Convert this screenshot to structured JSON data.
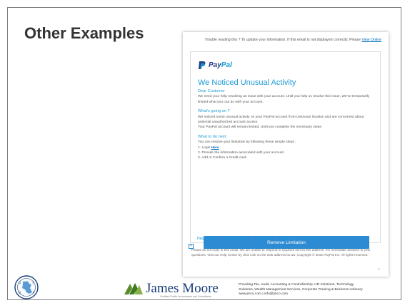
{
  "slide": {
    "title": "Other Examples"
  },
  "email": {
    "notice_text": "Trouble reading this ? To update your information. If this email is not displayed correctly, Please",
    "notice_link": "View Online",
    "logo_text_pay": "Pay",
    "logo_text_pal": "Pal",
    "heading": "We Noticed Unusual Activity",
    "greeting": "Dear Customer",
    "intro": "We need your help resolving an issue with your account. Until you help us resolve this issue, We've temporarily limited what you can do with your account.",
    "section1_title": "What's going on ?",
    "section1_text": "We noticed some unusual activity on your PayPal account from Unknown location and are concerned about potential unauthorized account access.",
    "section1_text2": "Your PayPal account will remain limited, Until you complete the necessary steps",
    "section2_title": "What to do next",
    "section2_intro": "You can resolve your limitation by following these simple steps :",
    "step1_prefix": "1. Login",
    "step1_link": "Here",
    "step1_suffix": ".",
    "step2": "2. Provide the information associated with your account.",
    "step3": "3. Add or Confirm a Credit card.",
    "button_label": "Remove Limitation",
    "links": [
      "Help Center",
      "Partner Directory",
      "Logo Center",
      "Security",
      "Business Center"
    ],
    "footer_text": "Please do not reply to this email. We are unable to respond to inquiries sent to this address. For immediate answers to your questions, Visit our Help Center by click Link on the web address be.aw ,Copyright © 2015 PayPal Inc. All rights reserved.",
    "footer_mark": "R"
  },
  "branding": {
    "company_name": "James Moore",
    "company_tagline": "Certified Public Accountants and Consultants",
    "info_line1": "Providing Tax, Audit, Accounting & Controllership, HR Solutions, Technology",
    "info_line2": "Solutions, Wealth Management Services, Corporate Training & Business Advisory.",
    "info_line3": "www.jmco.com  |  info@jmco.com",
    "seal_letters": "G F O A"
  },
  "colors": {
    "accent_blue": "#1e9ad6",
    "button_blue": "#2c8bd2",
    "paypal_navy": "#253b80",
    "brand_navy": "#1a3e7a",
    "brand_green": "#5a8a2a"
  }
}
